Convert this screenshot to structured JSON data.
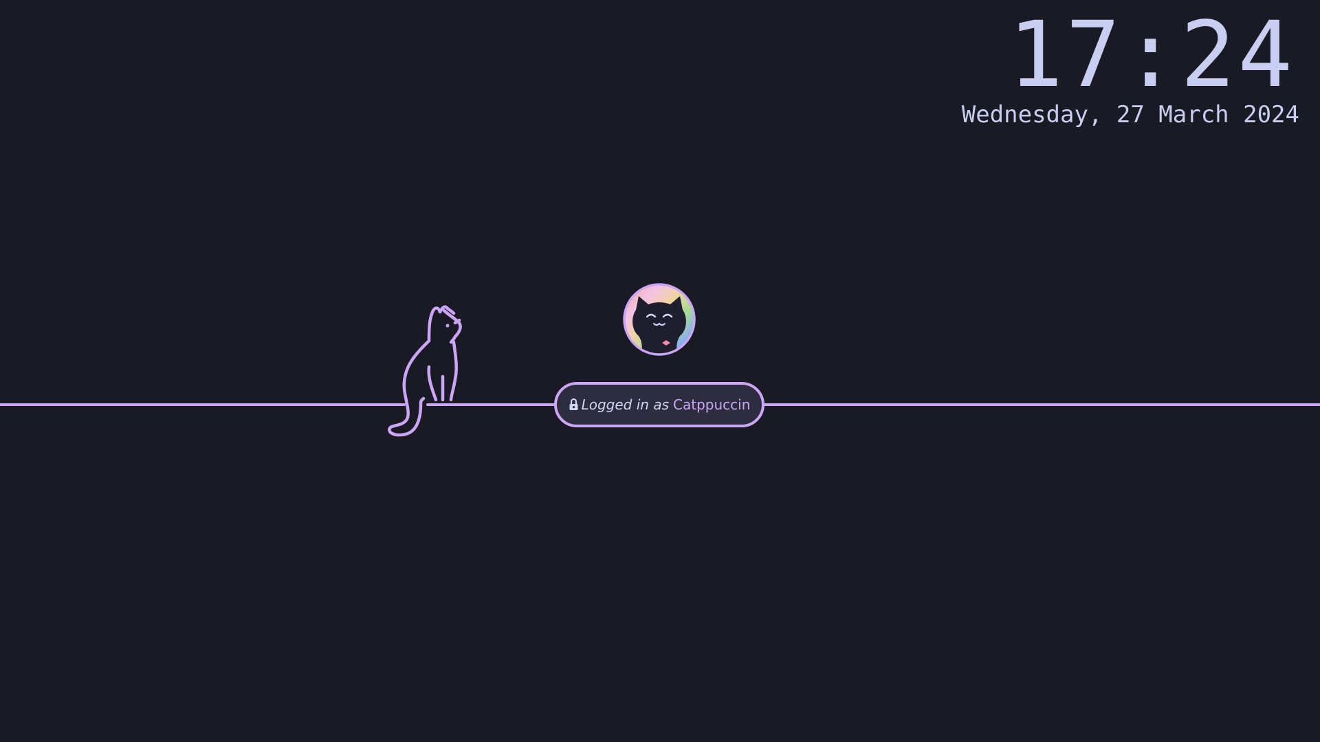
{
  "clock": {
    "time": "17:24",
    "date": "Wednesday, 27 March 2024"
  },
  "login": {
    "prefix": "Logged in as",
    "username": "Catppuccin",
    "icon": "lock-icon"
  },
  "user": {
    "avatar_icon": "cat-avatar-icon"
  },
  "decoration": {
    "icon": "cat-outline-icon"
  },
  "colors": {
    "background": "#1a1a24",
    "accent": "#cba6f7",
    "text": "#c8cdf2",
    "pill_background": "#2e2d40"
  }
}
